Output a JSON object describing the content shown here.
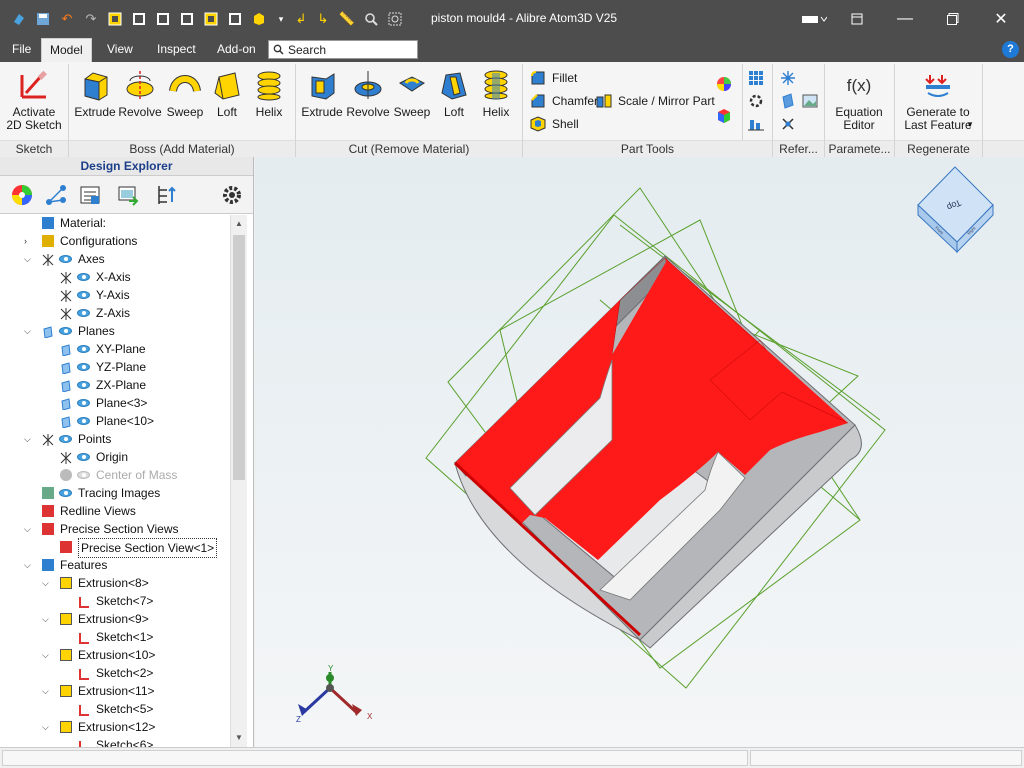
{
  "titlebar": {
    "title": "piston mould4 - Alibre Atom3D V25",
    "qat_icons": [
      "app-icon",
      "save-icon",
      "undo-icon",
      "redo-icon",
      "view-front-icon",
      "view-top-icon",
      "view-right-icon",
      "view-iso-icon",
      "view-iso2-icon",
      "view-shaded-icon",
      "dropdown-icon",
      "arrow-down-left-icon",
      "arrow-down-right-icon",
      "measure-icon",
      "zoom-icon",
      "zoom-window-icon"
    ]
  },
  "menu": {
    "tabs": [
      "File",
      "Model",
      "View",
      "Inspect",
      "Add-on"
    ],
    "active_tab": "Model",
    "search_placeholder": "Search"
  },
  "ribbon": {
    "sketch": {
      "activate_label": "Activate\n2D Sketch",
      "group": "Sketch"
    },
    "boss": {
      "items": [
        "Extrude",
        "Revolve",
        "Sweep",
        "Loft",
        "Helix"
      ],
      "group": "Boss (Add Material)"
    },
    "cut": {
      "items": [
        "Extrude",
        "Revolve",
        "Sweep",
        "Loft",
        "Helix"
      ],
      "group": "Cut (Remove Material)"
    },
    "part_tools": {
      "fillet": "Fillet",
      "chamfer": "Chamfer",
      "scale_mirror": "Scale / Mirror Part",
      "shell": "Shell",
      "group": "Part Tools"
    },
    "refer": {
      "group": "Refer..."
    },
    "parameters": {
      "equation_icon_text": "f(x)",
      "label": "Equation\nEditor",
      "group": "Paramete..."
    },
    "regenerate": {
      "label": "Generate to\nLast Feature",
      "group": "Regenerate"
    }
  },
  "explorer": {
    "title": "Design Explorer",
    "tree": [
      {
        "label": "Material:",
        "level": 1,
        "icon": "material-icon",
        "toggle": ""
      },
      {
        "label": "Configurations",
        "level": 1,
        "icon": "configurations-icon",
        "toggle": ">"
      },
      {
        "label": "Axes",
        "level": 1,
        "icon": "axes-icon",
        "toggle": "v",
        "eye": true
      },
      {
        "label": "X-Axis",
        "level": 2,
        "icon": "axis-icon",
        "eye": true
      },
      {
        "label": "Y-Axis",
        "level": 2,
        "icon": "axis-icon",
        "eye": true
      },
      {
        "label": "Z-Axis",
        "level": 2,
        "icon": "axis-icon",
        "eye": true
      },
      {
        "label": "Planes",
        "level": 1,
        "icon": "planes-icon",
        "toggle": "v",
        "eye": true
      },
      {
        "label": "XY-Plane",
        "level": 2,
        "icon": "plane-icon",
        "eye": true
      },
      {
        "label": "YZ-Plane",
        "level": 2,
        "icon": "plane-icon",
        "eye": true
      },
      {
        "label": "ZX-Plane",
        "level": 2,
        "icon": "plane-icon",
        "eye": true
      },
      {
        "label": "Plane<3>",
        "level": 2,
        "icon": "plane-icon",
        "eye": true
      },
      {
        "label": "Plane<10>",
        "level": 2,
        "icon": "plane-icon",
        "eye": true
      },
      {
        "label": "Points",
        "level": 1,
        "icon": "points-icon",
        "toggle": "v",
        "eye": true
      },
      {
        "label": "Origin",
        "level": 2,
        "icon": "point-icon",
        "eye": true
      },
      {
        "label": "Center of Mass",
        "level": 2,
        "icon": "center-of-mass-icon",
        "eye": true,
        "dim": true
      },
      {
        "label": "Tracing Images",
        "level": 1,
        "icon": "tracing-images-icon",
        "eye": true
      },
      {
        "label": "Redline Views",
        "level": 1,
        "icon": "redline-icon"
      },
      {
        "label": "Precise Section Views",
        "level": 1,
        "icon": "section-view-icon",
        "toggle": "v"
      },
      {
        "label": "Precise Section View<1>",
        "level": 2,
        "icon": "section-view-icon",
        "selected": true
      },
      {
        "label": "Features",
        "level": 1,
        "icon": "features-icon",
        "toggle": "v"
      },
      {
        "label": "Extrusion<8>",
        "level": 2,
        "icon": "extrusion-icon",
        "toggle": "v"
      },
      {
        "label": "Sketch<7>",
        "level": 3,
        "icon": "sketch-icon"
      },
      {
        "label": "Extrusion<9>",
        "level": 2,
        "icon": "extrusion-icon",
        "toggle": "v"
      },
      {
        "label": "Sketch<1>",
        "level": 3,
        "icon": "sketch-icon"
      },
      {
        "label": "Extrusion<10>",
        "level": 2,
        "icon": "extrusion-icon",
        "toggle": "v"
      },
      {
        "label": "Sketch<2>",
        "level": 3,
        "icon": "sketch-icon"
      },
      {
        "label": "Extrusion<11>",
        "level": 2,
        "icon": "extrusion-icon",
        "toggle": "v"
      },
      {
        "label": "Sketch<5>",
        "level": 3,
        "icon": "sketch-icon"
      },
      {
        "label": "Extrusion<12>",
        "level": 2,
        "icon": "extrusion-icon",
        "toggle": "v"
      },
      {
        "label": "Sketch<6>",
        "level": 3,
        "icon": "sketch-icon"
      }
    ]
  },
  "viewport": {
    "viewcube_top": "Top",
    "viewcube_front": "Front",
    "viewcube_right": "Right",
    "axis_labels": {
      "x": "X",
      "y": "Y",
      "z": "Z"
    },
    "colors": {
      "section_face": "#ff1a1a",
      "plane_lines": "#4c9a2a",
      "body_grey": "#a9abae"
    }
  }
}
